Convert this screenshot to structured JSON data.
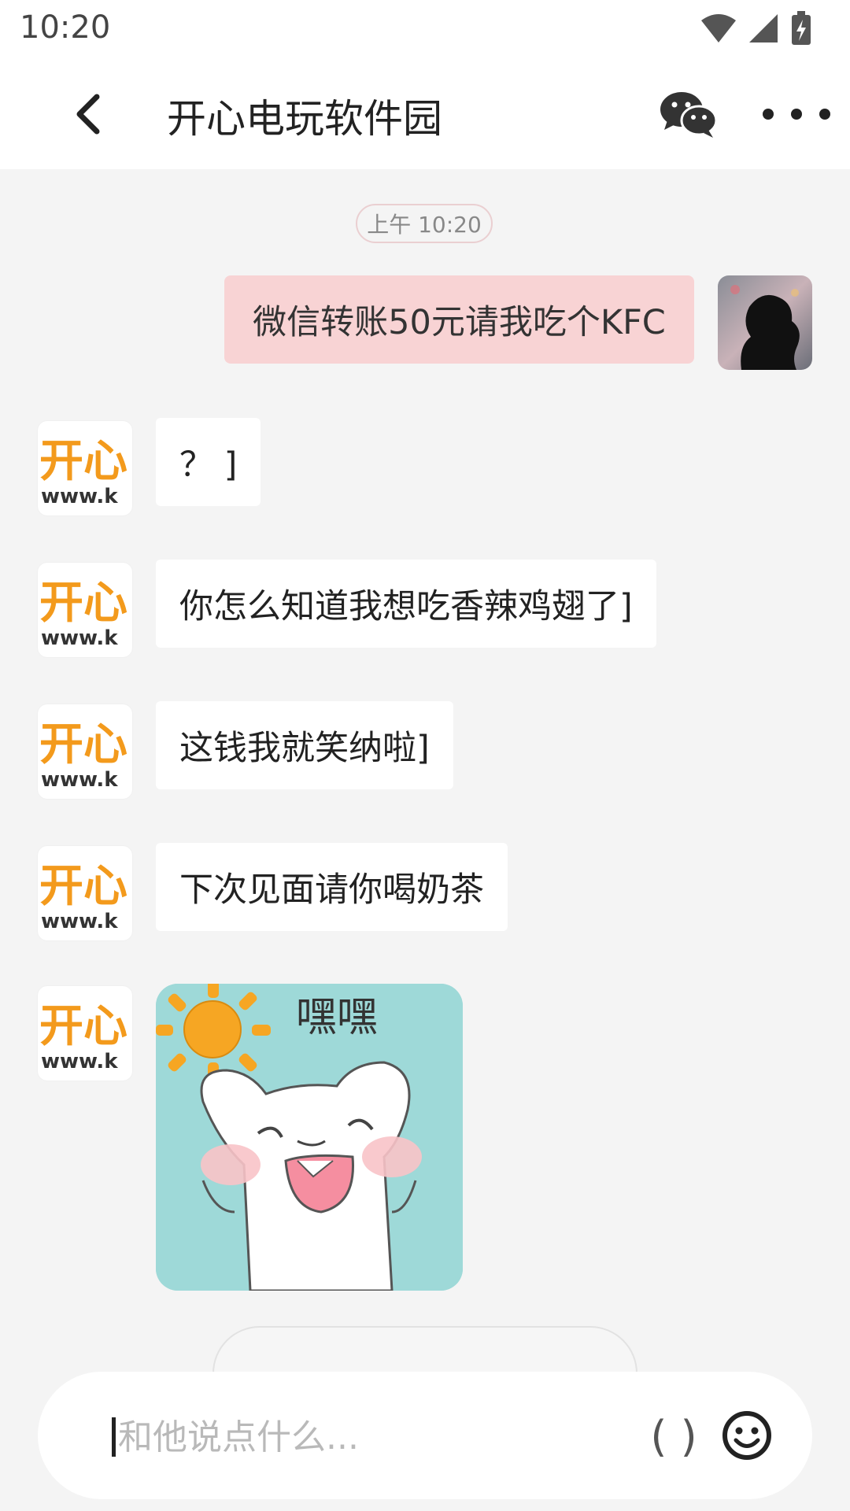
{
  "status_bar": {
    "time": "10:20",
    "icons": [
      "wifi-icon",
      "cell-signal-icon",
      "battery-charging-icon"
    ]
  },
  "header": {
    "title": "开心电玩软件园",
    "icons": [
      "back-icon",
      "wechat-icon",
      "more-icon"
    ]
  },
  "chat": {
    "timestamp": "上午 10:20",
    "self_message": "微信转账50元请我吃个KFC",
    "other_logo_text": "开心",
    "other_logo_url": "www.k",
    "other_messages": [
      "？ ]",
      "你怎么知道我想吃香辣鸡翅了]",
      "这钱我就笑纳啦]",
      "下次见面请你喝奶茶"
    ],
    "sticker_caption": "嘿嘿"
  },
  "input": {
    "placeholder": "和他说点什么...",
    "value": "",
    "paren_label": "( )",
    "emoji_icon": "smiley-icon"
  },
  "colors": {
    "self_bubble": "#f8d3d4",
    "timestamp_border": "#eacfd1",
    "logo_orange": "#f39a1c",
    "sticker_bg": "#9ed9d8"
  }
}
